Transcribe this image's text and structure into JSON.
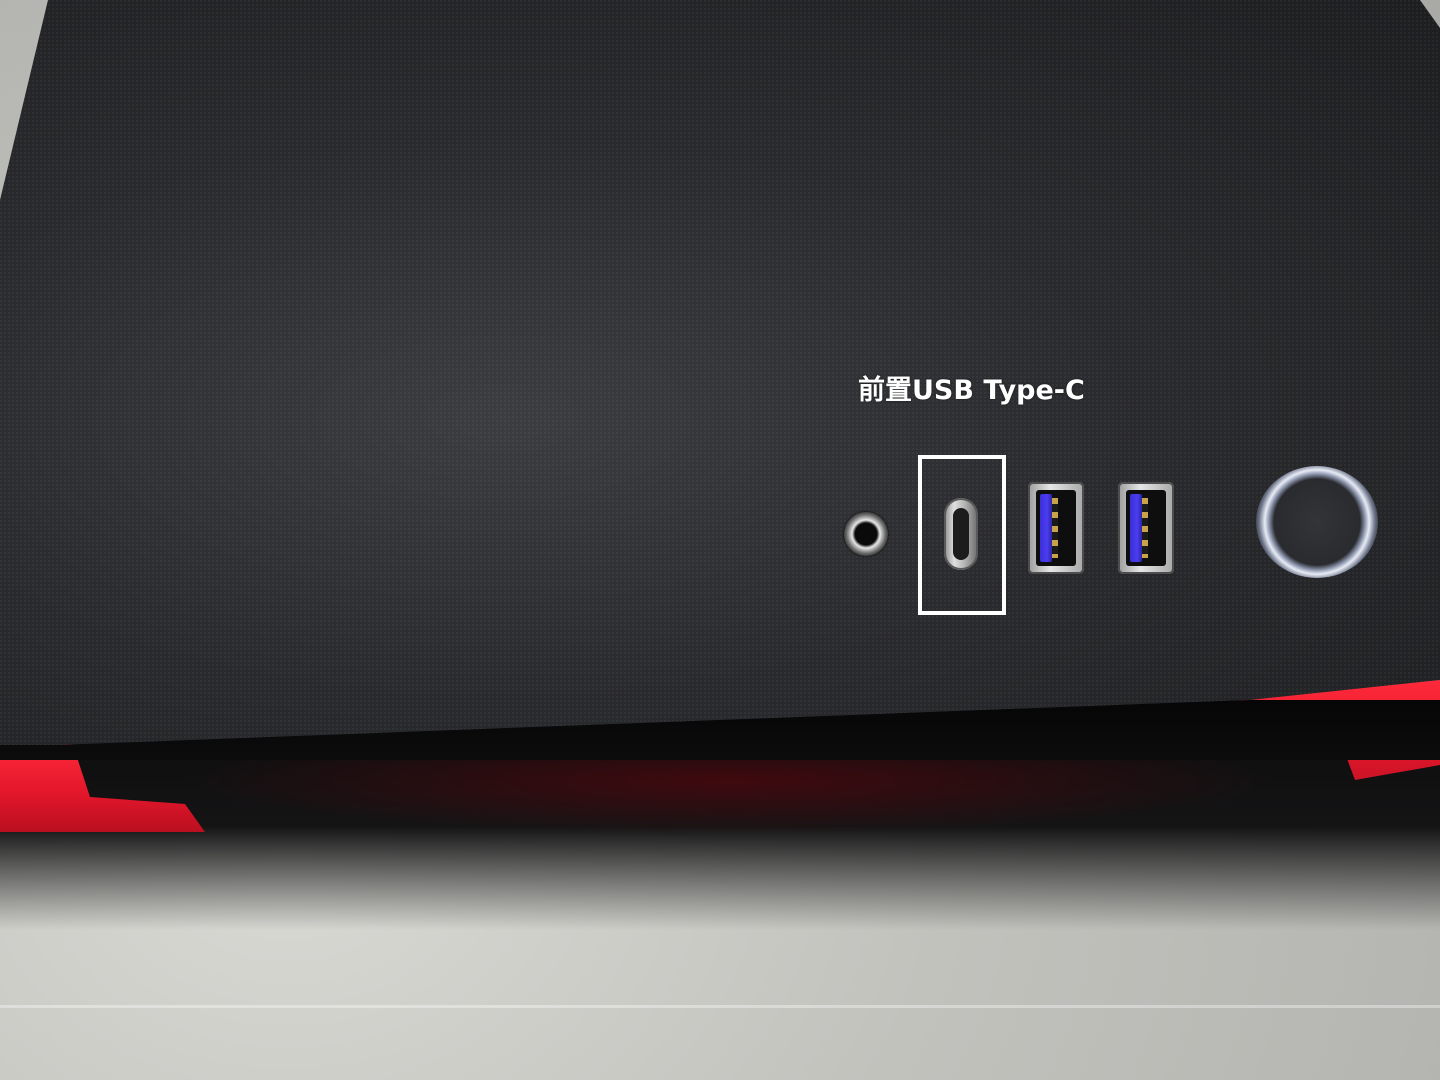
{
  "annotation": {
    "label": "前置USB Type-C"
  },
  "photo": {
    "subject_ports": [
      "audio-jack",
      "usb-type-c",
      "usb-a",
      "usb-a",
      "power-button"
    ],
    "colors": {
      "case_top": "#2a2b2e",
      "trim_red": "#e1162a",
      "usb_a_tongue": "#3a2fd9",
      "highlight_box": "#ffffff",
      "floor": "#c2c2bd"
    }
  }
}
